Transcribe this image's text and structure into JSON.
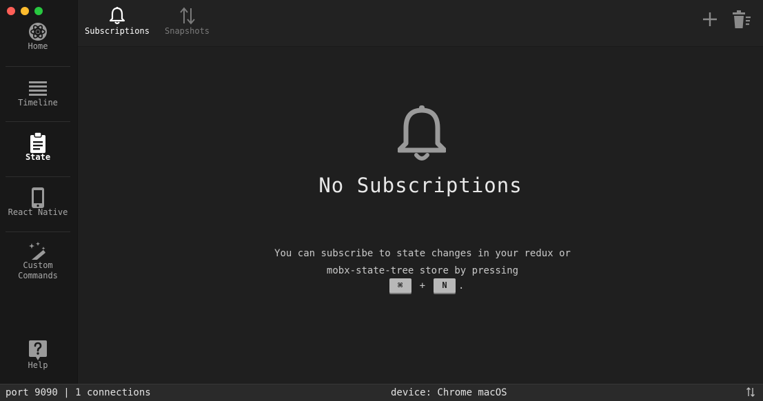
{
  "window": {
    "traffic_lights": {
      "close": "#ff5f57",
      "minimize": "#febc2e",
      "zoom": "#28c840"
    }
  },
  "sidebar": {
    "items": [
      {
        "label": "Home",
        "icon": "logo-icon",
        "active": false
      },
      {
        "label": "Timeline",
        "icon": "list-icon",
        "active": false
      },
      {
        "label": "State",
        "icon": "clipboard-icon",
        "active": true
      },
      {
        "label": "React Native",
        "icon": "phone-icon",
        "active": false
      },
      {
        "label": "Custom Commands",
        "icon": "magic-wand-icon",
        "active": false
      }
    ],
    "help": {
      "label": "Help",
      "icon": "help-icon"
    }
  },
  "topbar": {
    "tabs": [
      {
        "label": "Subscriptions",
        "icon": "bell-icon",
        "active": true
      },
      {
        "label": "Snapshots",
        "icon": "swap-vertical-icon",
        "active": false
      }
    ],
    "actions": [
      {
        "name": "add",
        "icon": "plus-icon"
      },
      {
        "name": "clear",
        "icon": "trash-icon"
      }
    ]
  },
  "main": {
    "empty_state": {
      "icon": "bell-icon",
      "title": "No Subscriptions",
      "description": "You can subscribe to state changes in your redux or mobx-state-tree store by pressing",
      "shortcut": {
        "key1": "⌘",
        "plus": "+",
        "key2": "N",
        "suffix": "."
      }
    }
  },
  "statusbar": {
    "connection": "port 9090 | 1 connections",
    "device": "device: Chrome macOS",
    "icon": "swap-vertical-icon"
  },
  "colors": {
    "background": "#1e1e1e",
    "sidebar": "#181818",
    "topbar": "#222222",
    "statusbar": "#2a2a2a",
    "accent": "#ffffff"
  }
}
